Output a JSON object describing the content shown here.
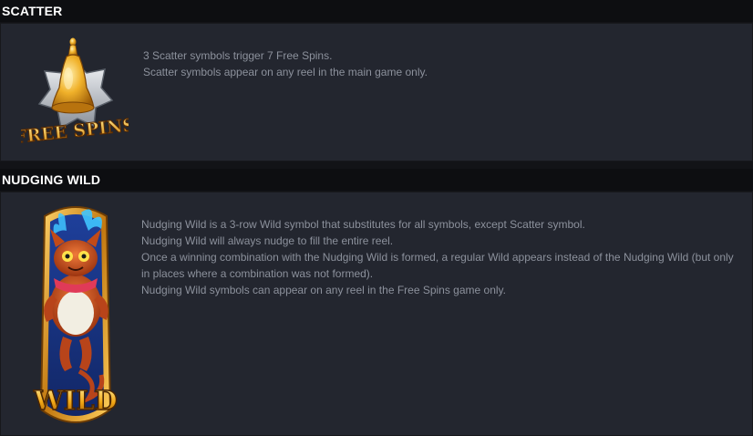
{
  "scatter": {
    "title": "SCATTER",
    "symbol_icon": "free-spins-bell-icon",
    "symbol_label": "FREE SPINS",
    "lines": [
      "3 Scatter symbols trigger 7 Free Spins.",
      "Scatter symbols appear on any reel in the main game only."
    ]
  },
  "nudging_wild": {
    "title": "NUDGING WILD",
    "symbol_icon": "wild-dragon-cat-icon",
    "symbol_label": "WILD",
    "lines": [
      "Nudging Wild is a 3-row Wild symbol that substitutes for all symbols, except Scatter symbol.",
      "Nudging Wild will always nudge to fill the entire reel.",
      "Once a winning combination with the Nudging Wild is formed, a regular Wild appears instead of the Nudging Wild (but only in places where a combination was not formed).",
      "Nudging Wild symbols can appear on any reel in the Free Spins game only."
    ]
  },
  "colors": {
    "header_bg": "#0d0e11",
    "panel_bg": "#23262f",
    "text": "#8c919c",
    "gold": "#e8a21a"
  }
}
